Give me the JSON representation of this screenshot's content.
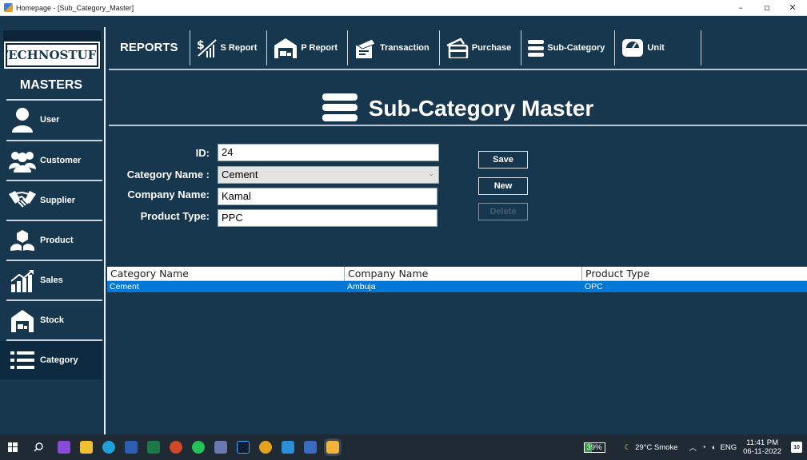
{
  "window": {
    "title": "Homepage - [Sub_Category_Master]",
    "minimize": "–",
    "maximize": "▫",
    "close": "✕"
  },
  "logo": {
    "text": "TECHNOSTUFF"
  },
  "sidebar": {
    "heading": "MASTERS",
    "items": [
      {
        "label": "User",
        "icon": "user-icon"
      },
      {
        "label": "Customer",
        "icon": "customers-icon"
      },
      {
        "label": "Supplier",
        "icon": "handshake-icon"
      },
      {
        "label": "Product",
        "icon": "product-icon"
      },
      {
        "label": "Sales",
        "icon": "sales-chart-icon"
      },
      {
        "label": "Stock",
        "icon": "stock-icon"
      },
      {
        "label": "Category",
        "icon": "list-icon"
      }
    ]
  },
  "toolbar": {
    "heading": "REPORTS",
    "buttons": [
      {
        "label": "S Report",
        "icon": "dollar-chart-icon"
      },
      {
        "label": "P Report",
        "icon": "warehouse-icon"
      },
      {
        "label": "Transaction",
        "icon": "transaction-icon"
      },
      {
        "label": "Purchase",
        "icon": "purchase-icon"
      },
      {
        "label": "Sub-Category",
        "icon": "menu-icon"
      },
      {
        "label": "Unit",
        "icon": "unit-icon"
      }
    ]
  },
  "header": {
    "title": "Sub-Category Master",
    "icon": "menu-icon"
  },
  "form": {
    "id_label": "ID:",
    "id_value": "24",
    "category_label": "Category Name :",
    "category_value": "Cement",
    "company_label": "Company Name:",
    "company_value": "Kamal",
    "product_type_label": "Product Type:",
    "product_type_value": "PPC",
    "save_label": "Save",
    "new_label": "New",
    "delete_label": "Delete"
  },
  "grid": {
    "columns": [
      "Category Name",
      "Company Name",
      "Product Type"
    ],
    "rows": [
      [
        "Cement",
        "Ambuja",
        "OPC"
      ]
    ]
  },
  "taskbar": {
    "battery": "39%",
    "weather": "29°C Smoke",
    "language": "ENG",
    "time": "11:41 PM",
    "date": "06-11-2022",
    "notif_count": "10"
  },
  "colors": {
    "background": "#17374f",
    "selection": "#0078d7",
    "taskbar": "#1f2a35"
  }
}
